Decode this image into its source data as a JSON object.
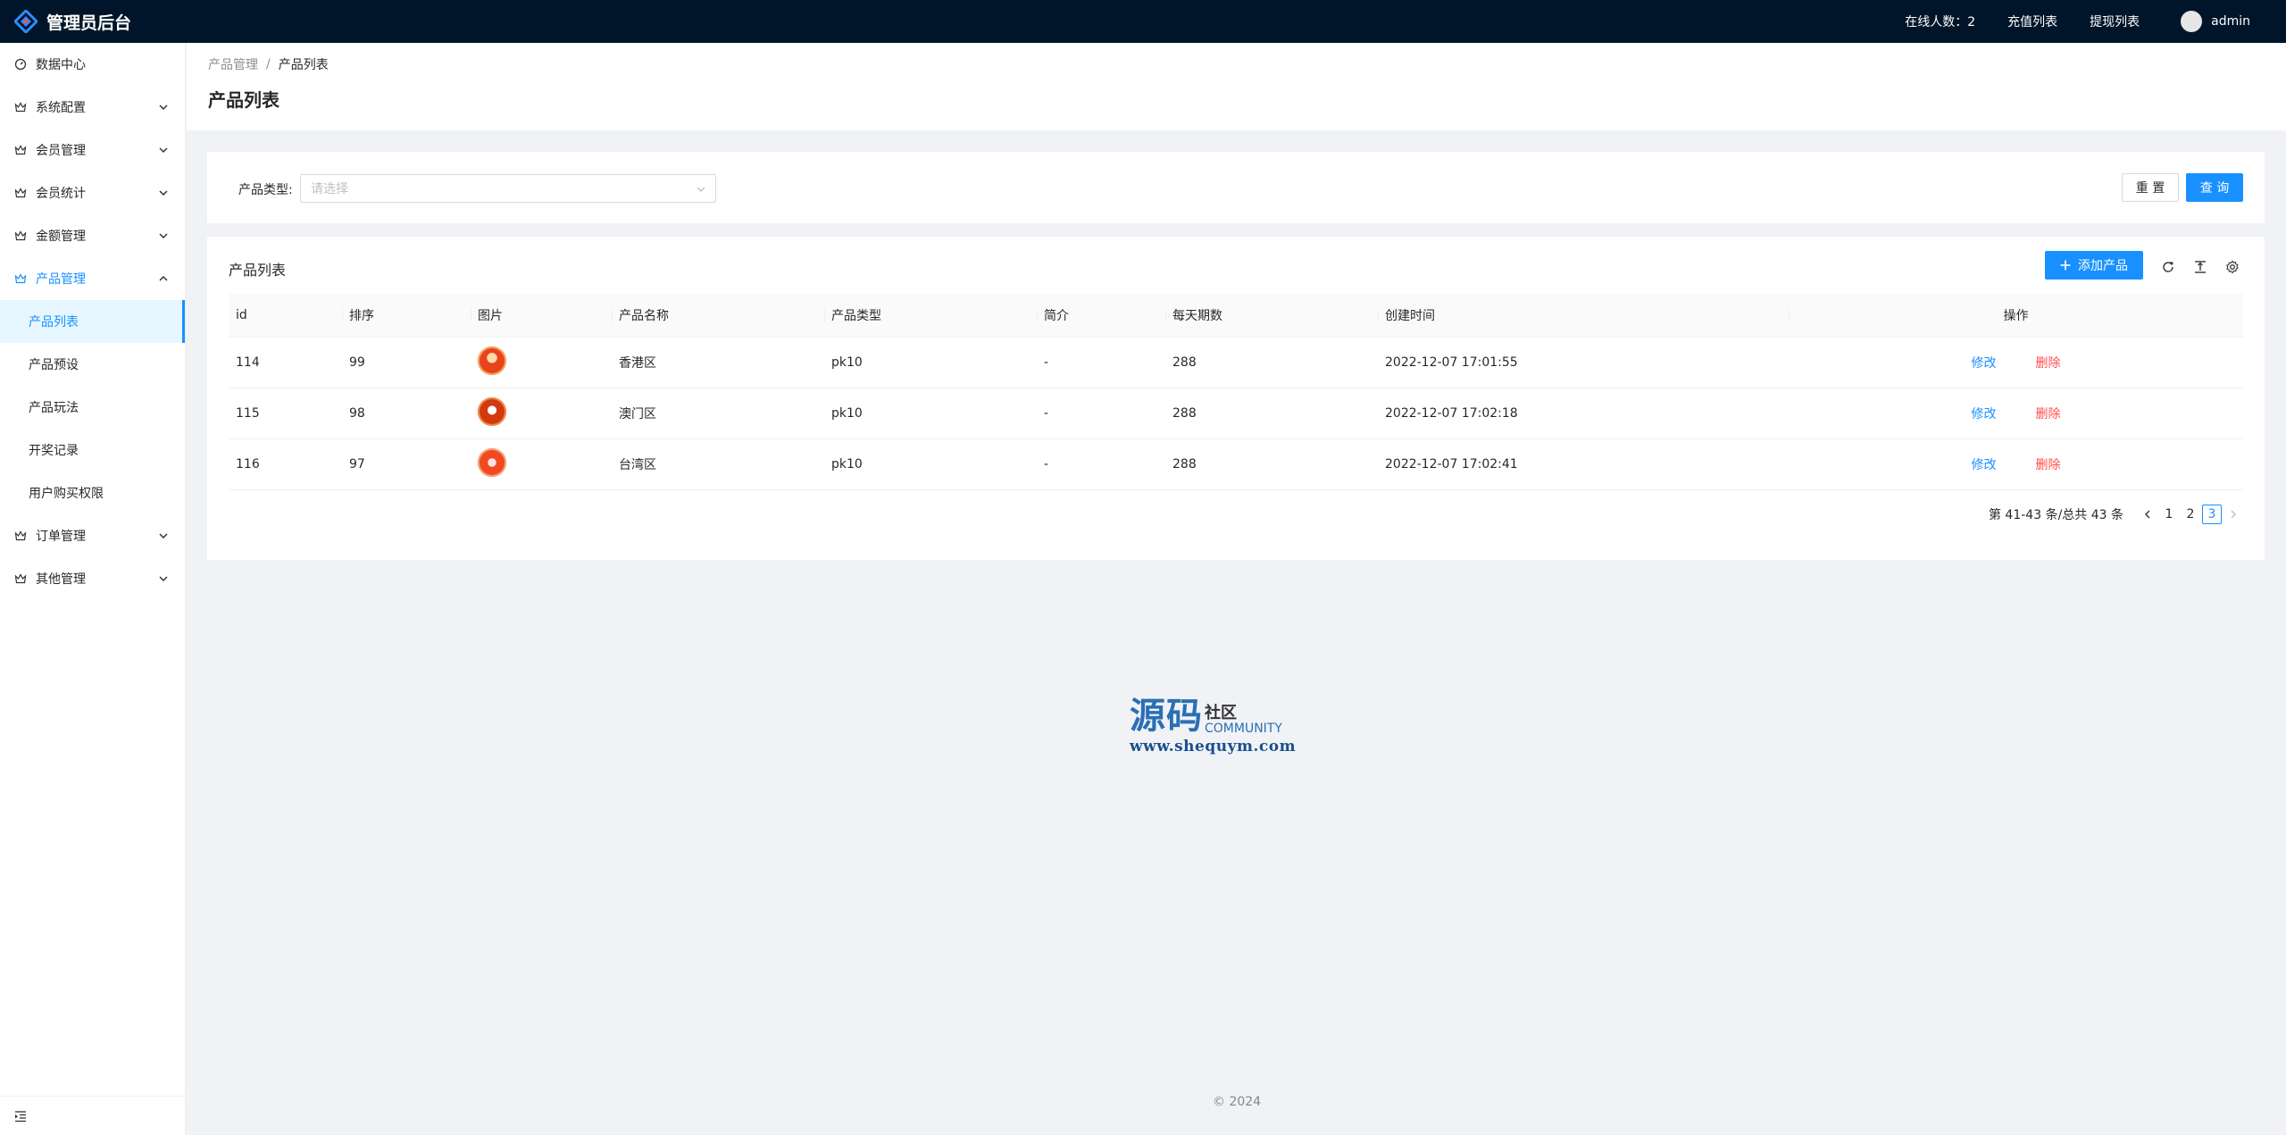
{
  "header": {
    "title": "管理员后台",
    "online_label": "在线人数：2",
    "recharge_list": "充值列表",
    "withdraw_list": "提现列表",
    "username": "admin"
  },
  "sidebar": {
    "items": [
      {
        "label": "数据中心",
        "icon": "dashboard-icon"
      },
      {
        "label": "系统配置",
        "icon": "crown-icon"
      },
      {
        "label": "会员管理",
        "icon": "crown-icon"
      },
      {
        "label": "会员统计",
        "icon": "crown-icon"
      },
      {
        "label": "金额管理",
        "icon": "crown-icon"
      },
      {
        "label": "产品管理",
        "icon": "crown-icon"
      },
      {
        "label": "订单管理",
        "icon": "crown-icon"
      },
      {
        "label": "其他管理",
        "icon": "crown-icon"
      }
    ],
    "sub_items": [
      "产品列表",
      "产品预设",
      "产品玩法",
      "开奖记录",
      "用户购买权限"
    ]
  },
  "breadcrumb": {
    "parent": "产品管理",
    "current": "产品列表"
  },
  "page_title": "产品列表",
  "search": {
    "type_label": "产品类型:",
    "type_placeholder": "请选择",
    "reset_label": "重 置",
    "query_label": "查 询"
  },
  "table": {
    "title": "产品列表",
    "add_label": "添加产品",
    "columns": [
      "id",
      "排序",
      "图片",
      "产品名称",
      "产品类型",
      "简介",
      "每天期数",
      "创建时间",
      "操作"
    ],
    "rows": [
      {
        "id": "114",
        "sort": "99",
        "name": "香港区",
        "type": "pk10",
        "intro": "-",
        "periods": "288",
        "created": "2022-12-07 17:01:55",
        "img_color": "#e8431b"
      },
      {
        "id": "115",
        "sort": "98",
        "name": "澳门区",
        "type": "pk10",
        "intro": "-",
        "periods": "288",
        "created": "2022-12-07 17:02:18",
        "img_color": "#d23a0e"
      },
      {
        "id": "116",
        "sort": "97",
        "name": "台湾区",
        "type": "pk10",
        "intro": "-",
        "periods": "288",
        "created": "2022-12-07 17:02:41",
        "img_color": "#f04a1e"
      }
    ],
    "edit_label": "修改",
    "delete_label": "删除"
  },
  "pagination": {
    "total_text": "第 41-43 条/总共 43 条",
    "pages": [
      "1",
      "2",
      "3"
    ],
    "current": "3"
  },
  "watermark": {
    "big": "源码",
    "small": "社区",
    "community": "COMMUNITY",
    "url": "www.shequym.com"
  },
  "footer": "© 2024",
  "colors": {
    "primary": "#1890ff",
    "danger": "#ff4d4f",
    "header_bg": "#001529"
  }
}
